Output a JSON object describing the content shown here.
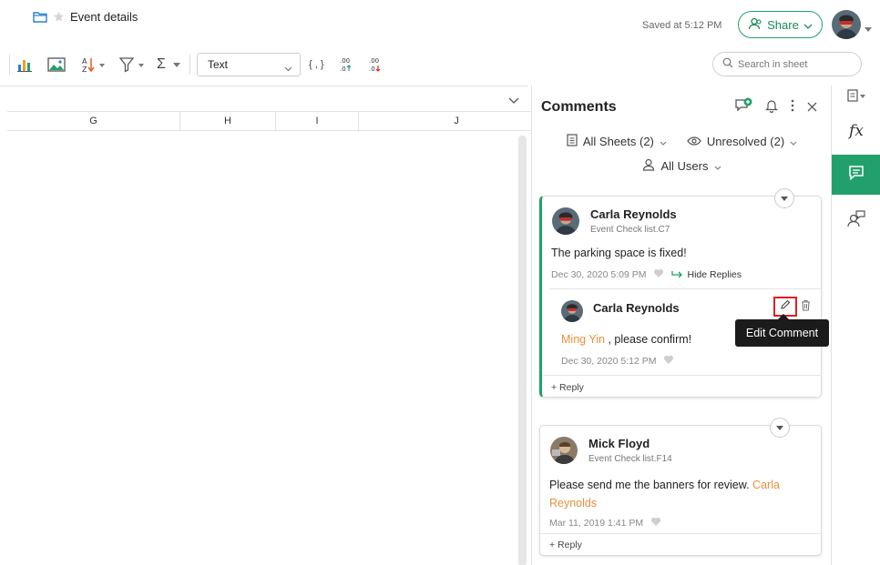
{
  "header": {
    "doc_title": "Event details",
    "saved_status": "Saved at 5:12 PM",
    "share_label": "Share"
  },
  "toolbar": {
    "font_value": "Text",
    "search_placeholder": "Search in sheet",
    "sum_symbol": "Σ",
    "brace_label": "{ , }",
    "decimal_increase": ".00",
    "decimal_decrease": ".00"
  },
  "sheet": {
    "columns": [
      "G",
      "H",
      "I",
      "J"
    ]
  },
  "comments_panel": {
    "title": "Comments",
    "filters": {
      "sheets": "All Sheets (2)",
      "status": "Unresolved (2)",
      "users": "All Users"
    },
    "threads": [
      {
        "author": "Carla Reynolds",
        "cell_ref": "Event Check list.C7",
        "text": "The parking space is fixed!",
        "timestamp": "Dec 30, 2020 5:09 PM",
        "hide_replies_label": "Hide Replies",
        "reply": {
          "author": "Carla Reynolds",
          "mention": "Ming Yin",
          "text": " , please confirm!",
          "timestamp": "Dec 30, 2020 5:12 PM"
        },
        "reply_label": "+ Reply"
      },
      {
        "author": "Mick Floyd",
        "cell_ref": "Event Check list.F14",
        "text": "Please send me the banners for review. ",
        "mention_line1": "Carla",
        "mention_line2": "Reynolds",
        "timestamp": "Mar 11, 2019 1:41 PM",
        "reply_label": "+ Reply"
      }
    ],
    "tooltip": "Edit Comment"
  },
  "rail": {
    "fx_label": "fx"
  },
  "colors": {
    "accent_green": "#22a06b",
    "mention_orange": "#e8903a",
    "highlight_red": "#e02020"
  }
}
